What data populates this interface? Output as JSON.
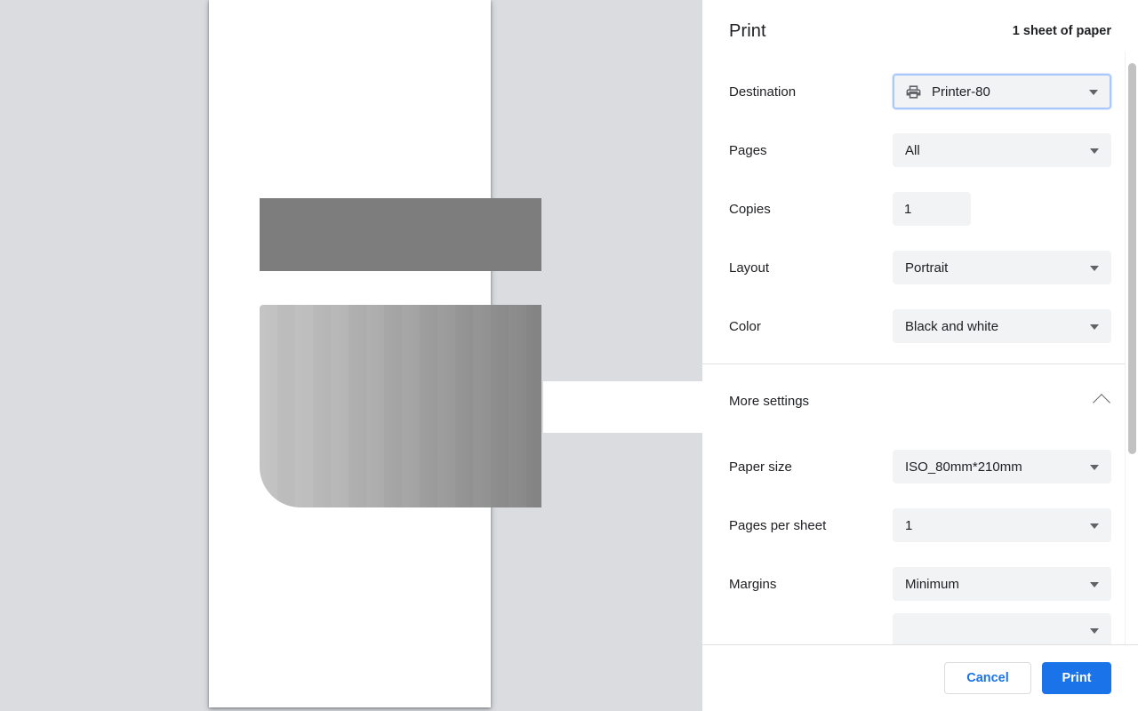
{
  "colors": {
    "accent": "#1a73e8",
    "focus_border": "#a8c7fa",
    "control_bg": "#f1f3f4",
    "page_bg": "#dadce0",
    "text": "#202124"
  },
  "header": {
    "title": "Print",
    "sheet_summary": "1 sheet of paper"
  },
  "settings": {
    "destination": {
      "label": "Destination",
      "value": "Printer-80",
      "icon": "printer-icon",
      "focused": true
    },
    "pages": {
      "label": "Pages",
      "value": "All"
    },
    "copies": {
      "label": "Copies",
      "value": "1"
    },
    "layout": {
      "label": "Layout",
      "value": "Portrait"
    },
    "color": {
      "label": "Color",
      "value": "Black and white"
    }
  },
  "more_settings": {
    "label": "More settings",
    "toggle_icon": "chevron-up-icon",
    "expanded": true,
    "paper_size": {
      "label": "Paper size",
      "value": "ISO_80mm*210mm"
    },
    "pages_per_sheet": {
      "label": "Pages per sheet",
      "value": "1"
    },
    "margins": {
      "label": "Margins",
      "value": "Minimum"
    }
  },
  "footer": {
    "cancel_label": "Cancel",
    "print_label": "Print"
  },
  "preview": {
    "page_label": "print-preview-page"
  }
}
